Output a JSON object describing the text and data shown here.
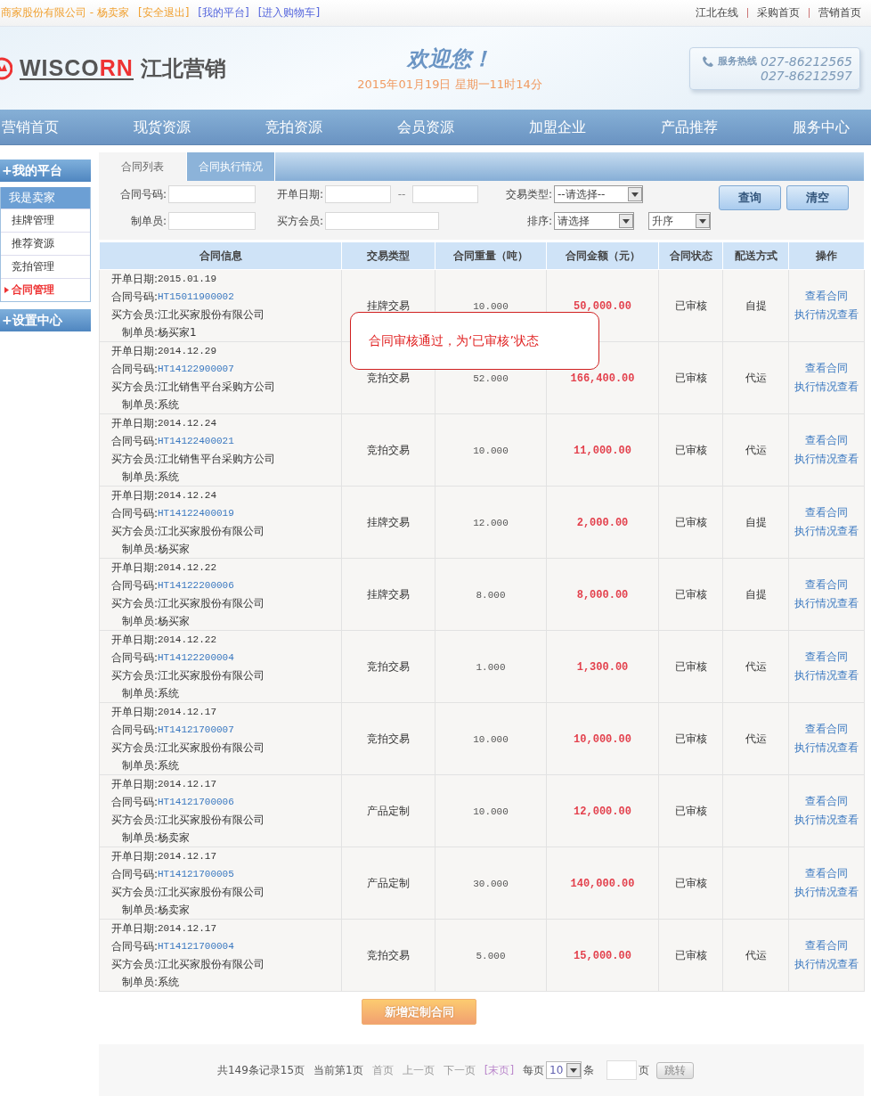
{
  "top_bar": {
    "user": "商家股份有限公司 - 杨卖家",
    "links": [
      "[安全退出]",
      "[我的平台]",
      "[进入购物车]"
    ],
    "right_links": [
      "江北在线",
      "采购首页",
      "营销首页"
    ]
  },
  "header": {
    "brand_main": "WISCO",
    "brand_accent": "RN",
    "brand_name": "江北营销",
    "welcome": "欢迎您！",
    "datetime": "2015年01月19日 星期一11时14分",
    "hotline_label": "服务热线",
    "hotline_numbers": [
      "027-86212565",
      "027-86212597"
    ]
  },
  "nav": [
    "营销首页",
    "现货资源",
    "竞拍资源",
    "会员资源",
    "加盟企业",
    "产品推荐",
    "服务中心"
  ],
  "sidebar": [
    {
      "title": "+我的平台",
      "group": "我是卖家",
      "items": [
        {
          "label": "挂牌管理",
          "selected": false
        },
        {
          "label": "推荐资源",
          "selected": false
        },
        {
          "label": "竞拍管理",
          "selected": false
        },
        {
          "label": "合同管理",
          "selected": true
        }
      ]
    },
    {
      "title": "+设置中心"
    }
  ],
  "tabs": [
    {
      "label": "合同列表",
      "selected": true
    },
    {
      "label": "合同执行情况",
      "selected": false
    }
  ],
  "filters": {
    "contract_no": "合同号码:",
    "date": "开单日期:",
    "date_sep": "--",
    "trade_type": "交易类型:",
    "trade_type_value": "--请选择--",
    "maker": "制单员:",
    "buyer": "买方会员:",
    "sort": "排序:",
    "sort_value": "请选择",
    "order_value": "升序",
    "buttons": [
      "查询",
      "清空"
    ]
  },
  "table": {
    "columns": [
      "合同信息",
      "交易类型",
      "合同重量（吨）",
      "合同金额（元）",
      "合同状态",
      "配送方式",
      "操作"
    ],
    "rows": [
      {
        "info": [
          {
            "label": "开单日期:",
            "value": "2015.01.19",
            "kind": "text"
          },
          {
            "label": "合同号码:",
            "value": "HT15011900002",
            "kind": "link"
          },
          {
            "label": "买方会员:",
            "value": "江北买家股份有限公司",
            "kind": "text"
          },
          {
            "label": "制单员:",
            "value": "杨买家1",
            "kind": "text"
          }
        ],
        "type": "挂牌交易",
        "weight": "10.000",
        "amount": "50,000.00",
        "status": "已审核",
        "delivery": "自提",
        "actions": [
          "查看合同",
          "执行情况查看"
        ]
      },
      {
        "info": [
          {
            "label": "开单日期:",
            "value": "2014.12.29",
            "kind": "text"
          },
          {
            "label": "合同号码:",
            "value": "HT14122900007",
            "kind": "link"
          },
          {
            "label": "买方会员:",
            "value": "江北销售平台采购方公司",
            "kind": "text"
          },
          {
            "label": "制单员:",
            "value": "系统",
            "kind": "text"
          }
        ],
        "type": "竞拍交易",
        "weight": "52.000",
        "amount": "166,400.00",
        "status": "已审核",
        "delivery": "代运",
        "actions": [
          "查看合同",
          "执行情况查看"
        ]
      },
      {
        "info": [
          {
            "label": "开单日期:",
            "value": "2014.12.24",
            "kind": "text"
          },
          {
            "label": "合同号码:",
            "value": "HT14122400021",
            "kind": "link"
          },
          {
            "label": "买方会员:",
            "value": "江北销售平台采购方公司",
            "kind": "text"
          },
          {
            "label": "制单员:",
            "value": "系统",
            "kind": "text"
          }
        ],
        "type": "竞拍交易",
        "weight": "10.000",
        "amount": "11,000.00",
        "status": "已审核",
        "delivery": "代运",
        "actions": [
          "查看合同",
          "执行情况查看"
        ]
      },
      {
        "info": [
          {
            "label": "开单日期:",
            "value": "2014.12.24",
            "kind": "text"
          },
          {
            "label": "合同号码:",
            "value": "HT14122400019",
            "kind": "link"
          },
          {
            "label": "买方会员:",
            "value": "江北买家股份有限公司",
            "kind": "text"
          },
          {
            "label": "制单员:",
            "value": "杨买家",
            "kind": "text"
          }
        ],
        "type": "挂牌交易",
        "weight": "12.000",
        "amount": "2,000.00",
        "status": "已审核",
        "delivery": "自提",
        "actions": [
          "查看合同",
          "执行情况查看"
        ]
      },
      {
        "info": [
          {
            "label": "开单日期:",
            "value": "2014.12.22",
            "kind": "text"
          },
          {
            "label": "合同号码:",
            "value": "HT14122200006",
            "kind": "link"
          },
          {
            "label": "买方会员:",
            "value": "江北买家股份有限公司",
            "kind": "text"
          },
          {
            "label": "制单员:",
            "value": "杨买家",
            "kind": "text"
          }
        ],
        "type": "挂牌交易",
        "weight": "8.000",
        "amount": "8,000.00",
        "status": "已审核",
        "delivery": "自提",
        "actions": [
          "查看合同",
          "执行情况查看"
        ]
      },
      {
        "info": [
          {
            "label": "开单日期:",
            "value": "2014.12.22",
            "kind": "text"
          },
          {
            "label": "合同号码:",
            "value": "HT14122200004",
            "kind": "link"
          },
          {
            "label": "买方会员:",
            "value": "江北买家股份有限公司",
            "kind": "text"
          },
          {
            "label": "制单员:",
            "value": "系统",
            "kind": "text"
          }
        ],
        "type": "竞拍交易",
        "weight": "1.000",
        "amount": "1,300.00",
        "status": "已审核",
        "delivery": "代运",
        "actions": [
          "查看合同",
          "执行情况查看"
        ]
      },
      {
        "info": [
          {
            "label": "开单日期:",
            "value": "2014.12.17",
            "kind": "text"
          },
          {
            "label": "合同号码:",
            "value": "HT14121700007",
            "kind": "link"
          },
          {
            "label": "买方会员:",
            "value": "江北买家股份有限公司",
            "kind": "text"
          },
          {
            "label": "制单员:",
            "value": "系统",
            "kind": "text"
          }
        ],
        "type": "竞拍交易",
        "weight": "10.000",
        "amount": "10,000.00",
        "status": "已审核",
        "delivery": "代运",
        "actions": [
          "查看合同",
          "执行情况查看"
        ]
      },
      {
        "info": [
          {
            "label": "开单日期:",
            "value": "2014.12.17",
            "kind": "text"
          },
          {
            "label": "合同号码:",
            "value": "HT14121700006",
            "kind": "link"
          },
          {
            "label": "买方会员:",
            "value": "江北买家股份有限公司",
            "kind": "text"
          },
          {
            "label": "制单员:",
            "value": "杨卖家",
            "kind": "text"
          }
        ],
        "type": "产品定制",
        "weight": "10.000",
        "amount": "12,000.00",
        "status": "已审核",
        "actions": [
          "查看合同",
          "执行情况查看"
        ]
      },
      {
        "info": [
          {
            "label": "开单日期:",
            "value": "2014.12.17",
            "kind": "text"
          },
          {
            "label": "合同号码:",
            "value": "HT14121700005",
            "kind": "link"
          },
          {
            "label": "买方会员:",
            "value": "江北买家股份有限公司",
            "kind": "text"
          },
          {
            "label": "制单员:",
            "value": "杨卖家",
            "kind": "text"
          }
        ],
        "type": "产品定制",
        "weight": "30.000",
        "amount": "140,000.00",
        "status": "已审核",
        "actions": [
          "查看合同",
          "执行情况查看"
        ]
      },
      {
        "info": [
          {
            "label": "开单日期:",
            "value": "2014.12.17",
            "kind": "text"
          },
          {
            "label": "合同号码:",
            "value": "HT14121700004",
            "kind": "link"
          },
          {
            "label": "买方会员:",
            "value": "江北买家股份有限公司",
            "kind": "text"
          },
          {
            "label": "制单员:",
            "value": "系统",
            "kind": "text"
          }
        ],
        "type": "竞拍交易",
        "weight": "5.000",
        "amount": "15,000.00",
        "status": "已审核",
        "delivery": "代运",
        "actions": [
          "查看合同",
          "执行情况查看"
        ]
      }
    ]
  },
  "callout": "合同审核通过，为‘已审核’状态",
  "add_button": "新增定制合同",
  "pagination": {
    "summary": "共149条记录15页",
    "current": "当前第1页",
    "links": [
      "首页",
      "上一页",
      "下一页",
      "[末页]"
    ],
    "per_page_label": "每页",
    "per_page": "10",
    "per_page_unit": "条",
    "page_unit": "页",
    "jump": "跳转"
  }
}
